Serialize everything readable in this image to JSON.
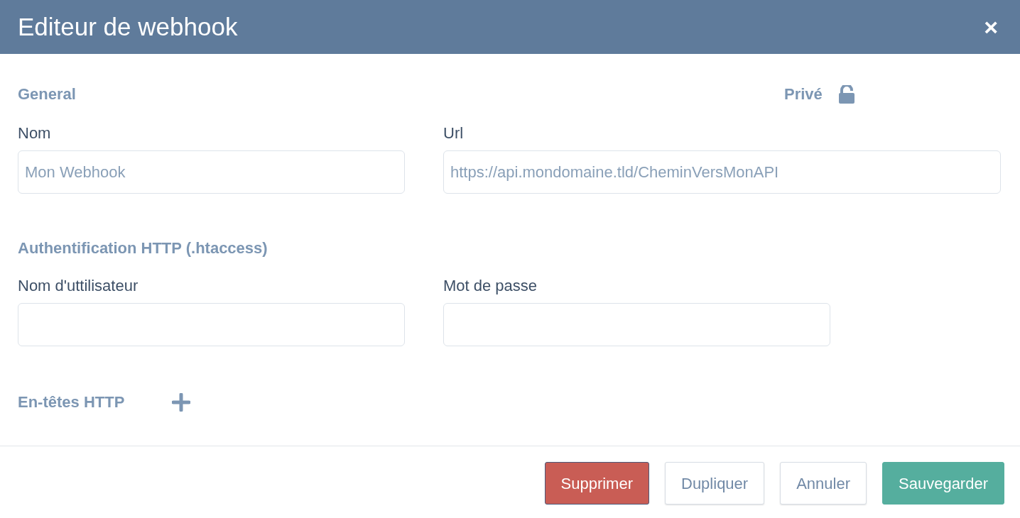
{
  "dialog": {
    "title": "Editeur de webhook",
    "close": "×"
  },
  "general": {
    "heading": "General",
    "private": {
      "label": "Privé",
      "locked": false
    },
    "fields": [
      {
        "label": "Nom",
        "placeholder": "Mon Webhook",
        "wide": false
      },
      {
        "label": "Url",
        "placeholder": "https://api.mondomaine.tld/CheminVersMonAPI",
        "wide": true
      }
    ]
  },
  "auth": {
    "heading": "Authentification HTTP (.htaccess)",
    "fields": [
      {
        "label": "Nom d'uttilisateur"
      },
      {
        "label": "Mot de passe"
      }
    ]
  },
  "headers": {
    "heading": "En-têtes HTTP"
  },
  "buttons": [
    {
      "label": "Supprimer",
      "kind": "danger"
    },
    {
      "label": "Dupliquer",
      "kind": "plain"
    },
    {
      "label": "Annuler",
      "kind": "plain"
    },
    {
      "label": "Sauvegarder",
      "kind": "primary"
    }
  ]
}
